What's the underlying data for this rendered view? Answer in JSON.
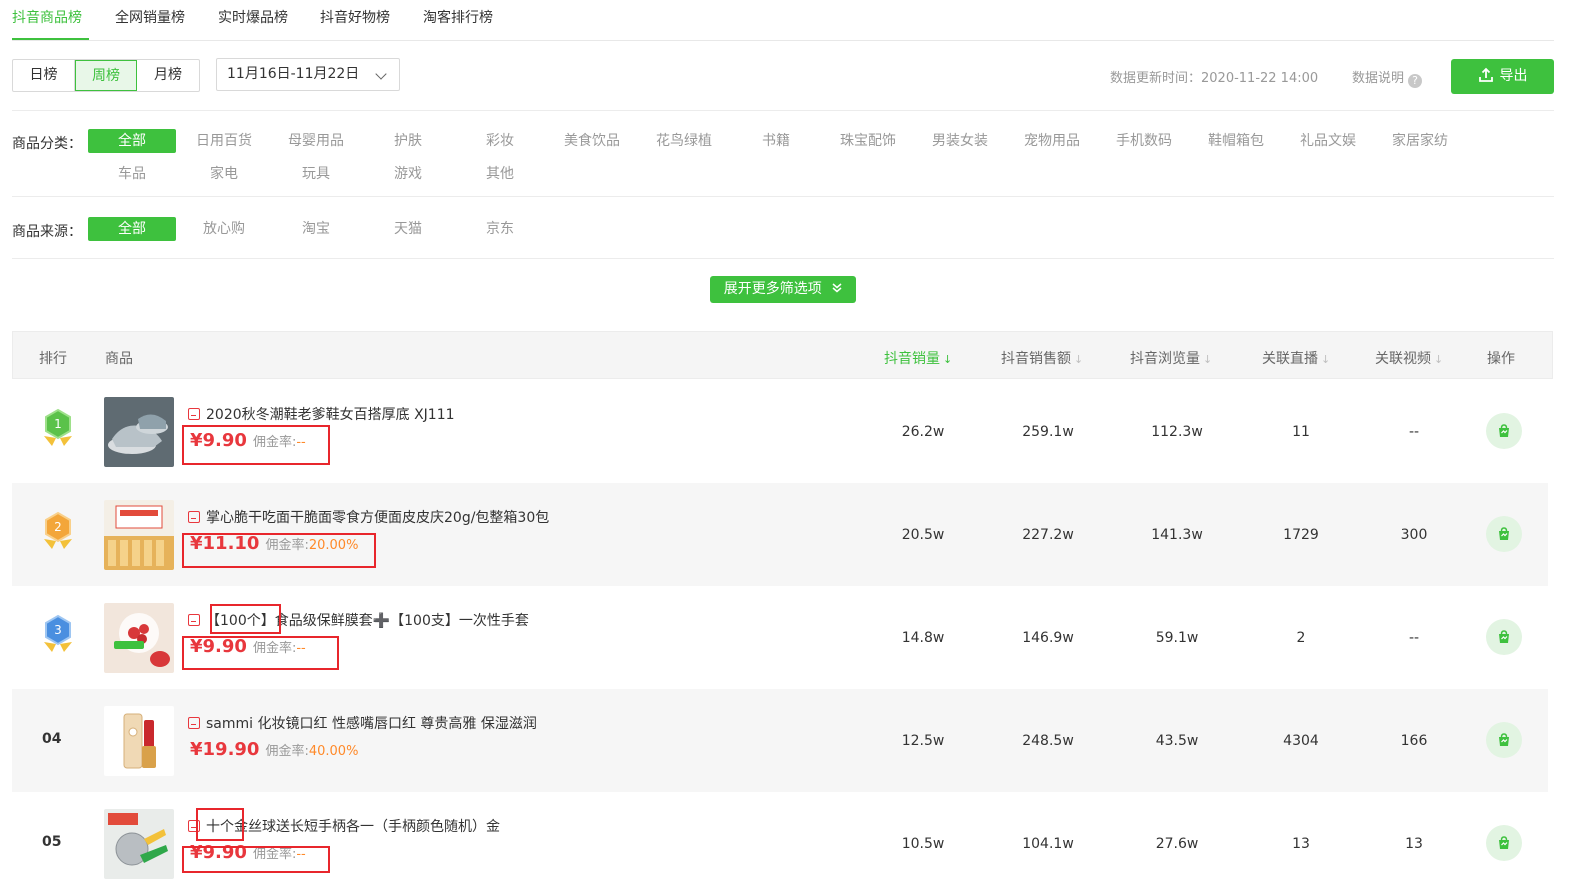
{
  "tabs": [
    "抖音商品榜",
    "全网销量榜",
    "实时爆品榜",
    "抖音好物榜",
    "淘客排行榜"
  ],
  "period": {
    "options": [
      "日榜",
      "周榜",
      "月榜"
    ],
    "active": 1
  },
  "date_range": "11月16日-11月22日",
  "update_time": "数据更新时间：2020-11-22 14:00",
  "data_note": "数据说明",
  "export_label": "导出",
  "category": {
    "label": "商品分类：",
    "items": [
      "全部",
      "日用百货",
      "母婴用品",
      "护肤",
      "彩妆",
      "美食饮品",
      "花鸟绿植",
      "书籍",
      "珠宝配饰",
      "男装女装",
      "宠物用品",
      "手机数码",
      "鞋帽箱包",
      "礼品文娱",
      "家居家纺",
      "车品",
      "家电",
      "玩具",
      "游戏",
      "其他"
    ]
  },
  "source": {
    "label": "商品来源：",
    "items": [
      "全部",
      "放心购",
      "淘宝",
      "天猫",
      "京东"
    ]
  },
  "expand_label": "展开更多筛选项",
  "table": {
    "headers": {
      "rank": "排行",
      "product": "商品",
      "sales": "抖音销量",
      "revenue": "抖音销售额",
      "views": "抖音浏览量",
      "live": "关联直播",
      "video": "关联视频",
      "op": "操作"
    },
    "rows": [
      {
        "rank": "1",
        "title": "2020秋冬潮鞋老爹鞋女百搭厚底 XJ111",
        "price": "¥9.90",
        "rate_label": "佣金率:",
        "rate": "--",
        "sales": "26.2w",
        "revenue": "259.1w",
        "views": "112.3w",
        "live": "11",
        "video": "--"
      },
      {
        "rank": "2",
        "title": "掌心脆干吃面干脆面零食方便面皮皮庆20g/包整箱30包",
        "price": "¥11.10",
        "rate_label": "佣金率:",
        "rate": "20.00%",
        "sales": "20.5w",
        "revenue": "227.2w",
        "views": "141.3w",
        "live": "1729",
        "video": "300"
      },
      {
        "rank": "3",
        "title": "【100个】食品级保鲜膜套➕【100支】一次性手套",
        "price": "¥9.90",
        "rate_label": "佣金率:",
        "rate": "--",
        "sales": "14.8w",
        "revenue": "146.9w",
        "views": "59.1w",
        "live": "2",
        "video": "--"
      },
      {
        "rank": "04",
        "title": "sammi 化妆镜口红 性感嘴唇口红 尊贵高雅 保湿滋润",
        "price": "¥19.90",
        "rate_label": "佣金率:",
        "rate": "40.00%",
        "sales": "12.5w",
        "revenue": "248.5w",
        "views": "43.5w",
        "live": "4304",
        "video": "166"
      },
      {
        "rank": "05",
        "title": "十个金丝球送长短手柄各一（手柄颜色随机）金",
        "price": "¥9.90",
        "rate_label": "佣金率:",
        "rate": "--",
        "sales": "10.5w",
        "revenue": "104.1w",
        "views": "27.6w",
        "live": "13",
        "video": "13"
      }
    ]
  },
  "colors": {
    "accent": "#3ec13e",
    "price": "#e8373d",
    "rate": "#ff8a2a",
    "highlight_box": "#e8262c"
  }
}
